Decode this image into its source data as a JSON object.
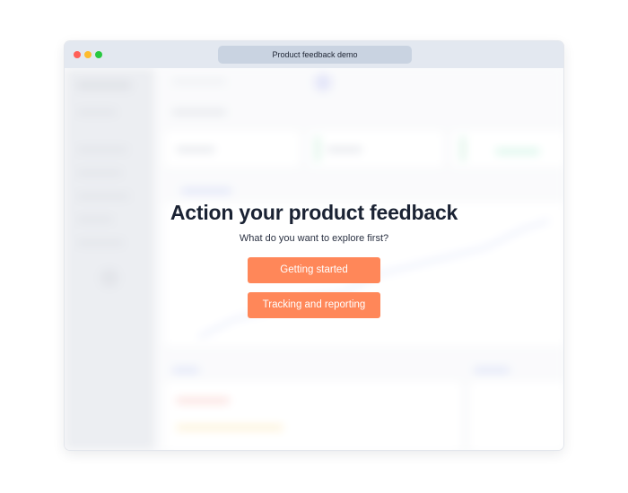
{
  "window": {
    "title": "Product feedback demo"
  },
  "modal": {
    "headline": "Action your product feedback",
    "subline": "What do you want to explore first?",
    "buttons": [
      {
        "label": "Getting started"
      },
      {
        "label": "Tracking and reporting"
      }
    ]
  },
  "colors": {
    "accent": "#ff8759",
    "traffic_red": "#ff5f57",
    "traffic_yellow": "#febc2e",
    "traffic_green": "#28c840",
    "titlebar": "#e3e8f0",
    "urlbar": "#c9d3e1",
    "text_primary": "#1a2233"
  },
  "icons": [
    "close-dot-icon",
    "minimize-dot-icon",
    "zoom-dot-icon"
  ]
}
